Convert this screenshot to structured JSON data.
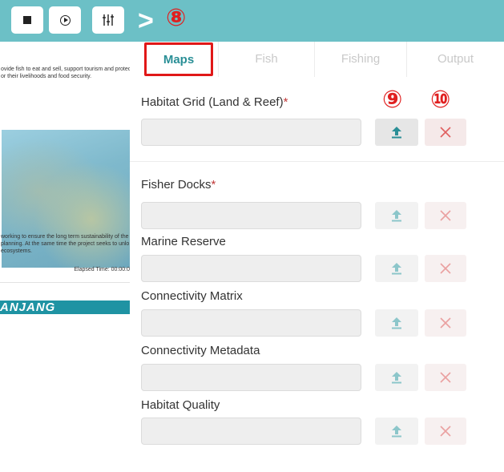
{
  "toolbar": {
    "stop_icon": "stop-icon",
    "play_icon": "play-circle-icon",
    "settings_icon": "sliders-icon",
    "chevron": ">",
    "step_marker": "⑧"
  },
  "left_pane": {
    "intro_line1": "ovide fish to eat and sell, support tourism and protec",
    "intro_line2": "or their livelihoods and food security.",
    "body_line1": " working to ensure the long term sustainability of the",
    "body_line2": " planning. At the same time the project seeks to unlo",
    "body_line3": " ecosystems.",
    "elapsed": "Elapsed Time: 00:00:0",
    "banner": "ANJANG"
  },
  "tabs": [
    {
      "label": "Maps",
      "active": true
    },
    {
      "label": "Fish",
      "active": false
    },
    {
      "label": "Fishing",
      "active": false
    },
    {
      "label": "Output",
      "active": false
    }
  ],
  "markers": {
    "upload": "⑨",
    "clear": "⑩"
  },
  "fields": [
    {
      "label": "Habitat Grid (Land & Reef)",
      "required": "*",
      "value": "",
      "upload_icon": "upload-icon",
      "clear_icon": "close-icon"
    },
    {
      "label": "Fisher Docks",
      "required": "*",
      "value": "",
      "upload_icon": "upload-icon",
      "clear_icon": "close-icon"
    },
    {
      "label": "Marine Reserve",
      "required": "",
      "value": "",
      "upload_icon": "upload-icon",
      "clear_icon": "close-icon"
    },
    {
      "label": "Connectivity Matrix",
      "required": "",
      "value": "",
      "upload_icon": "upload-icon",
      "clear_icon": "close-icon"
    },
    {
      "label": "Connectivity Metadata",
      "required": "",
      "value": "",
      "upload_icon": "upload-icon",
      "clear_icon": "close-icon"
    },
    {
      "label": "Habitat Quality",
      "required": "",
      "value": "",
      "upload_icon": "upload-icon",
      "clear_icon": "close-icon"
    }
  ],
  "colors": {
    "accent": "#6cc0c6",
    "active_tab": "#2a8f96",
    "highlight": "#e01818",
    "required": "#c03a3a"
  }
}
